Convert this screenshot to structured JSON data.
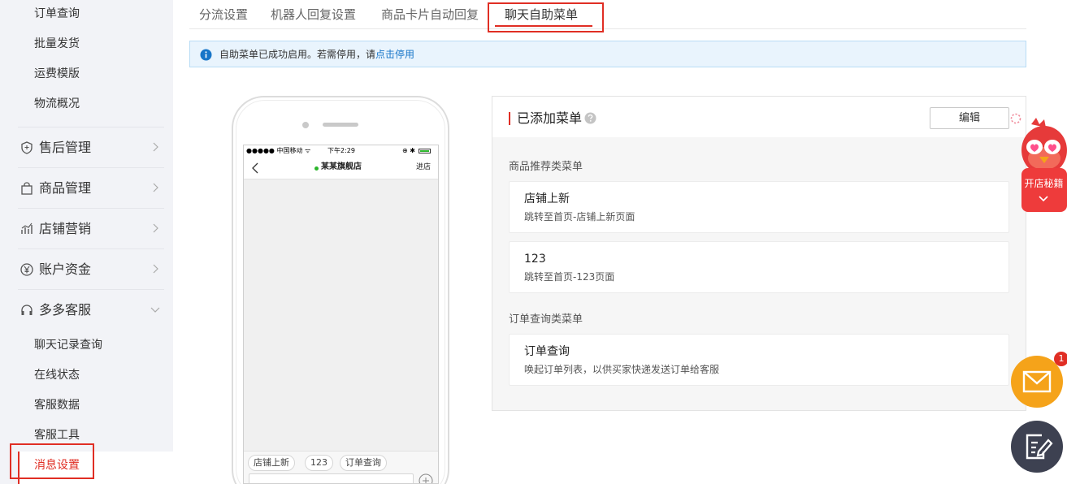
{
  "sidebar": {
    "top_items": [
      "订单查询",
      "批量发货",
      "运费模版",
      "物流概况"
    ],
    "nav_items": [
      {
        "label": "售后管理",
        "icon": "shield-icon",
        "expanded": false
      },
      {
        "label": "商品管理",
        "icon": "bag-icon",
        "expanded": false
      },
      {
        "label": "店铺营销",
        "icon": "chart-icon",
        "expanded": false
      },
      {
        "label": "账户资金",
        "icon": "yen-icon",
        "expanded": false
      },
      {
        "label": "多多客服",
        "icon": "headset-icon",
        "expanded": true
      }
    ],
    "service_items": [
      "聊天记录查询",
      "在线状态",
      "客服数据",
      "客服工具",
      "消息设置"
    ],
    "active_item": "消息设置"
  },
  "tabs": [
    "分流设置",
    "机器人回复设置",
    "商品卡片自动回复",
    "聊天自助菜单"
  ],
  "active_tab": "聊天自助菜单",
  "notice": {
    "text": "自助菜单已成功启用。若需停用，请",
    "link": "点击停用"
  },
  "phone": {
    "carrier": "●●●●● 中国移动 ᯤ",
    "time": "下午2:29",
    "status_right": "⊕ ✱",
    "shop_name": "某某旗舰店",
    "enter_label": "进店",
    "chips": [
      "店铺上新",
      "123",
      "订单查询"
    ]
  },
  "card": {
    "title": "已添加菜单",
    "edit_label": "编辑",
    "sections": [
      {
        "label": "商品推荐类菜单",
        "items": [
          {
            "name": "店铺上新",
            "desc": "跳转至首页-店铺上新页面"
          },
          {
            "name": "123",
            "desc": "跳转至首页-123页面"
          }
        ]
      },
      {
        "label": "订单查询类菜单",
        "items": [
          {
            "name": "订单查询",
            "desc": "唤起订单列表，以供买家快递发送订单给客服"
          }
        ]
      }
    ]
  },
  "widgets": {
    "mascot_label": "开店秘籍",
    "mail_badge": "1"
  },
  "colors": {
    "accent_red": "#e02e24",
    "link_blue": "#1775c8",
    "mail_orange": "#f5a31a",
    "sidebar_bg": "#f2f3f7"
  }
}
